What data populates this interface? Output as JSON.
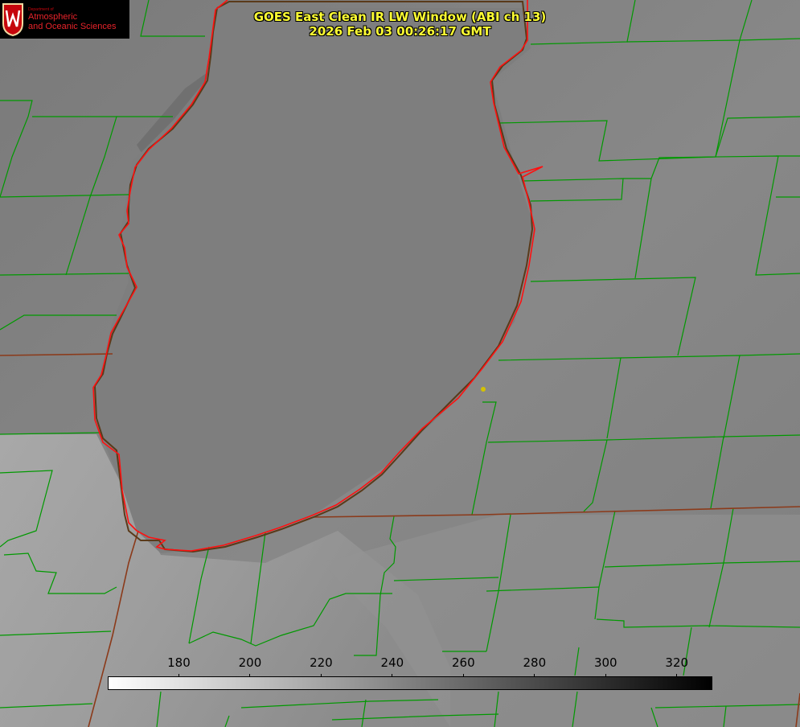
{
  "header": {
    "title_line1": "GOES East Clean IR LW Window (ABI ch 13)",
    "title_line2": "2026 Feb 03 00:26:17 GMT",
    "title_color": "#ffff33"
  },
  "logo": {
    "dept_line1": "Department of",
    "name_line1": "Atmospheric",
    "name_line2": "and Oceanic Sciences",
    "brand_color": "#c5050c"
  },
  "map": {
    "feature": "lake-outline",
    "shoreline_color": "#ff0000",
    "state_border_color": "#8b3a1a",
    "county_border_color": "#009900",
    "marker_color": "#d4c200"
  },
  "colorbar": {
    "min": 160,
    "max": 330,
    "colormap": "gray-white-to-black",
    "ticks": [
      "180",
      "200",
      "220",
      "240",
      "260",
      "280",
      "300",
      "320"
    ]
  }
}
